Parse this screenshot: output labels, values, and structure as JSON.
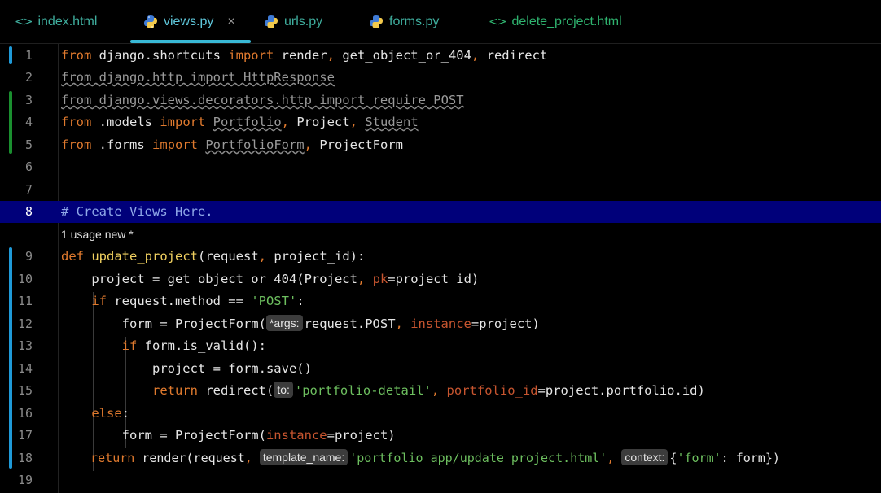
{
  "tabs": [
    {
      "label": "index.html",
      "icon": "html-icon",
      "active": false
    },
    {
      "label": "views.py",
      "icon": "python-icon",
      "active": true,
      "close": "×"
    },
    {
      "label": "urls.py",
      "icon": "python-icon",
      "active": false
    },
    {
      "label": "forms.py",
      "icon": "python-icon",
      "active": false
    },
    {
      "label": "delete_project.html",
      "icon": "html-icon",
      "active": false
    }
  ],
  "html_icon_glyph": "<>",
  "line_numbers": [
    "1",
    "2",
    "3",
    "4",
    "5",
    "6",
    "7",
    "8",
    "9",
    "10",
    "11",
    "12",
    "13",
    "14",
    "15",
    "16",
    "17",
    "18",
    "19"
  ],
  "usage_hint": "1 usage   new *",
  "hints": {
    "args": "*args:",
    "to": "to:",
    "template_name": "template_name:",
    "context": "context:"
  },
  "code": {
    "l1": [
      "from",
      " django.shortcuts ",
      "import",
      " render",
      ", ",
      "get_object_or_404",
      ", ",
      "redirect"
    ],
    "l2": "from django.http import HttpResponse",
    "l3": "from django.views.decorators.http import require_POST",
    "l4": [
      "from",
      " .models ",
      "import",
      " ",
      "Portfolio",
      ", ",
      "Project",
      ", ",
      "Student"
    ],
    "l5": [
      "from",
      " .forms ",
      "import",
      " ",
      "PortfolioForm",
      ", ",
      "ProjectForm"
    ],
    "l8": "# Create Views Here.",
    "l9": [
      "def",
      " ",
      "update_project",
      "(request",
      ", ",
      "project_id):"
    ],
    "l10": [
      "    project = get_object_or_404(Project",
      ", ",
      "pk",
      "=project_id)"
    ],
    "l11": [
      "    ",
      "if",
      " request.method == ",
      "'POST'",
      ":"
    ],
    "l12": [
      "        form = ProjectForm(",
      "request.POST",
      ", ",
      "instance",
      "=project)"
    ],
    "l13": [
      "        ",
      "if",
      " form.is_valid():"
    ],
    "l14": "            project = form.save()",
    "l15": [
      "            ",
      "return",
      " redirect(",
      "'portfolio-detail'",
      ", ",
      "portfolio_id",
      "=project.portfolio.id)"
    ],
    "l16": [
      "    ",
      "else",
      ":"
    ],
    "l17": [
      "        form = ProjectForm(",
      "instance",
      "=project)"
    ],
    "l18": [
      "    ",
      "return",
      " render(request",
      ", ",
      "'portfolio_app/update_project.html'",
      ", ",
      "{",
      "'form'",
      ": form})"
    ]
  },
  "colors": {
    "keyword": "#e07a2e",
    "function": "#f0d060",
    "string": "#6dbf5f",
    "comment": "#8fa8e8",
    "param": "#c7552f",
    "highlight_line": "#00007a",
    "active_tab_underline": "#39b9d6"
  }
}
